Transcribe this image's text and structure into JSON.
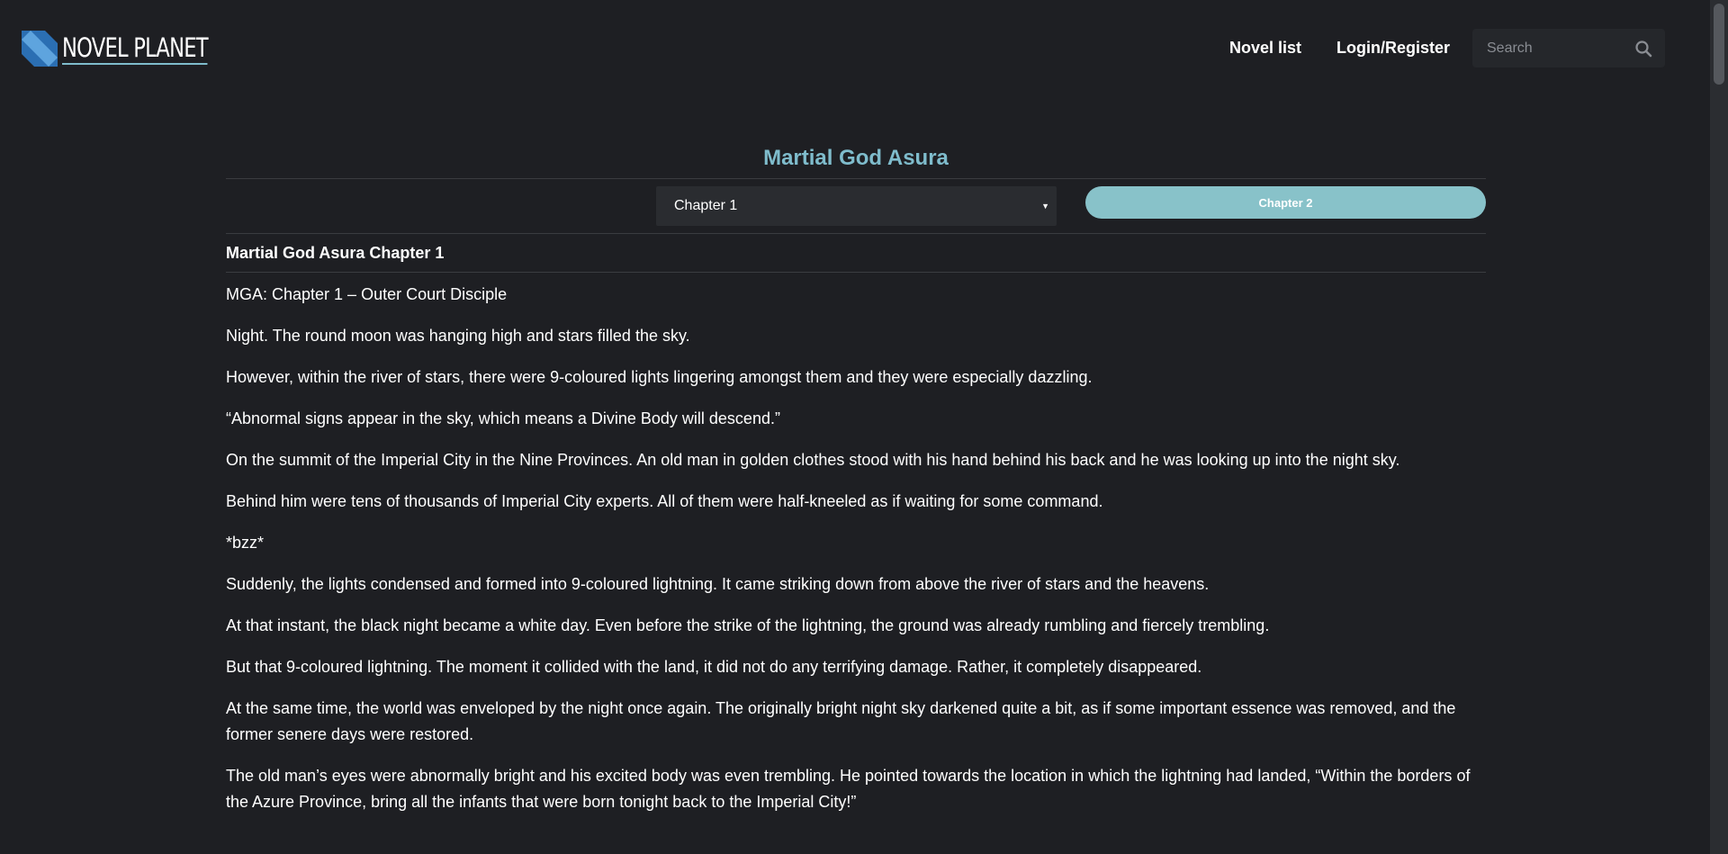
{
  "header": {
    "logo_text": "NOVEL PLANET",
    "nav": [
      {
        "label": "Novel list"
      },
      {
        "label": "Login/Register"
      }
    ],
    "search": {
      "placeholder": "Search",
      "value": ""
    }
  },
  "novel": {
    "title": "Martial God Asura",
    "chapter_select": {
      "selected": "Chapter 1"
    },
    "next_chapter_label": "Chapter 2",
    "chapter_heading": "Martial God Asura Chapter 1",
    "paragraphs": [
      "MGA: Chapter 1 – Outer Court Disciple",
      "Night. The round moon was hanging high and stars filled the sky.",
      "However, within the river of stars, there were 9-coloured lights lingering amongst them and they were especially dazzling.",
      "“Abnormal signs appear in the sky, which means a Divine Body will descend.”",
      "On the summit of the Imperial City in the Nine Provinces. An old man in golden clothes stood with his hand behind his back and he was looking up into the night sky.",
      "Behind him were tens of thousands of Imperial City experts. All of them were half-kneeled as if waiting for some command.",
      "*bzz*",
      "Suddenly, the lights condensed and formed into 9-coloured lightning. It came striking down from above the river of stars and the heavens.",
      "At that instant, the black night became a white day. Even before the strike of the lightning, the ground was already rumbling and fiercely trembling.",
      "But that 9-coloured lightning. The moment it collided with the land, it did not do any terrifying damage. Rather, it completely disappeared.",
      "At the same time, the world was enveloped by the night once again. The originally bright night sky darkened quite a bit, as if some important essence was removed, and the former senere days were restored.",
      "The old man’s eyes were abnormally bright and his excited body was even trembling. He pointed towards the location in which the lightning had landed, “Within the borders of the Azure Province, bring all the infants that were born tonight back to the Imperial City!”"
    ]
  },
  "colors": {
    "background": "#1e1f23",
    "accent": "#7fbccc",
    "button": "#88c2c9"
  },
  "icons": {
    "logo": "logo-mark-icon",
    "search": "search-icon",
    "dropdown": "dropdown-arrow-icon"
  }
}
